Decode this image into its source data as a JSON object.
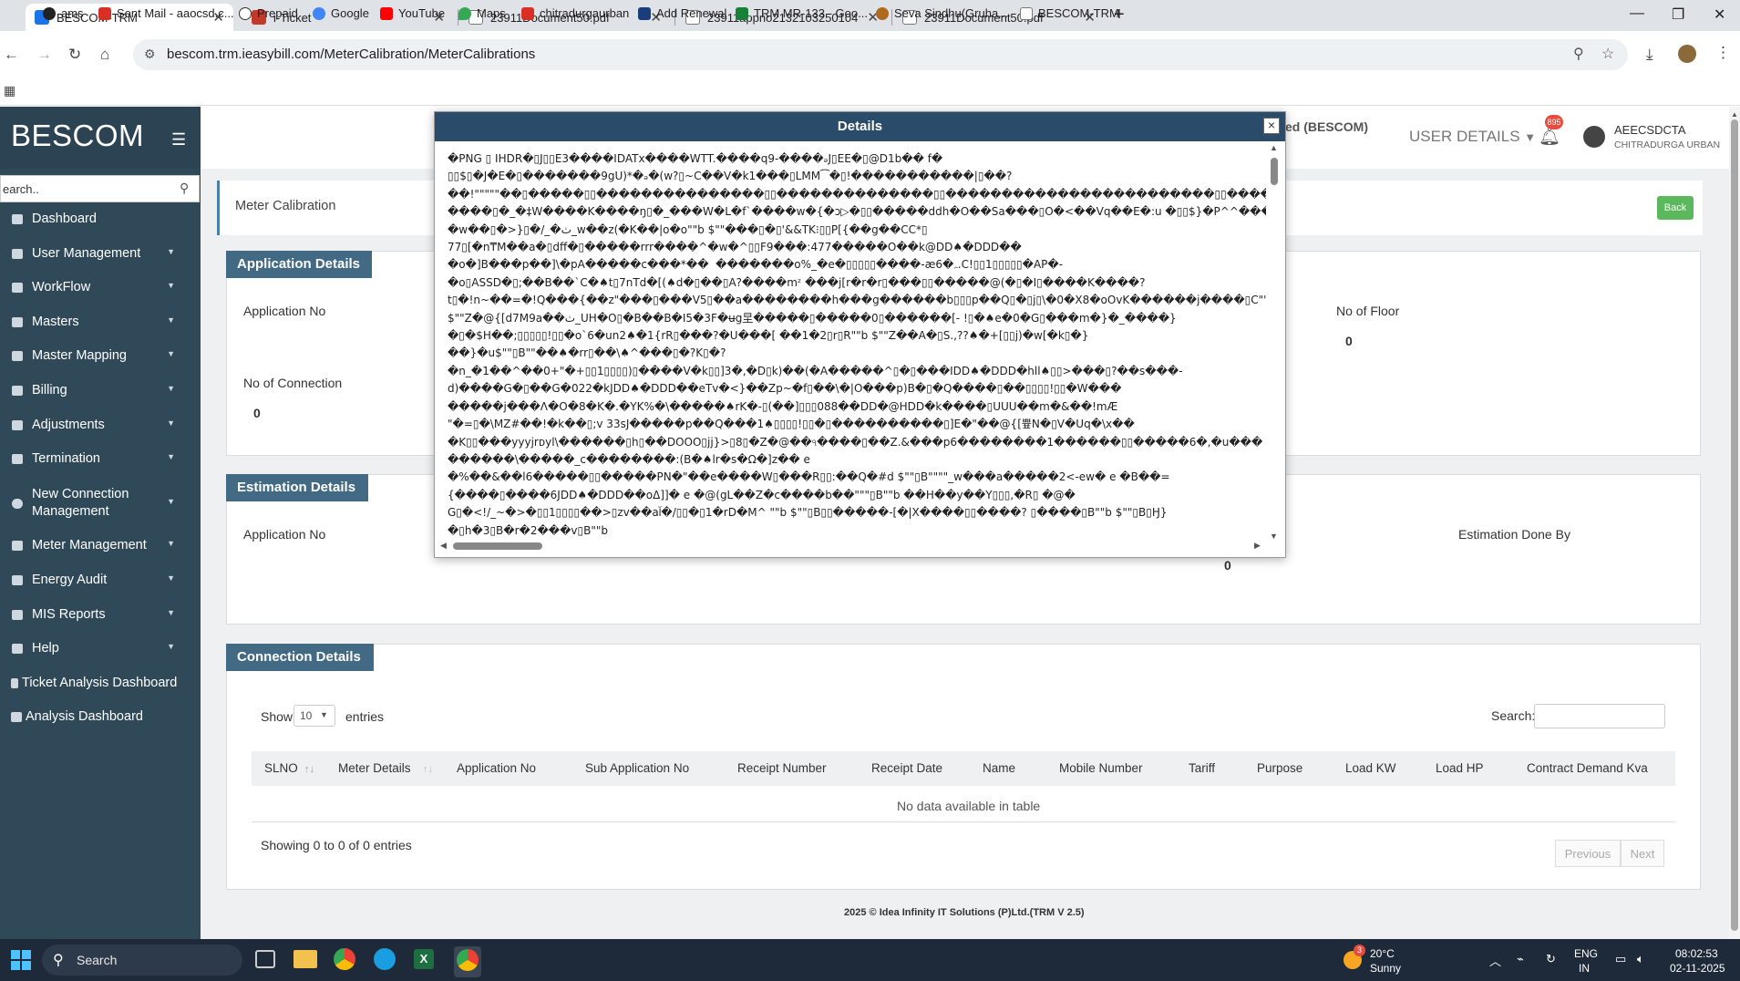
{
  "browser": {
    "tabs": [
      {
        "title": "BESCOM-TRM",
        "active": true
      },
      {
        "title": "i-Ticket",
        "active": false
      },
      {
        "title": "23911Document50.pdf",
        "active": false
      },
      {
        "title": "23911appno2132103250104ae",
        "active": false
      },
      {
        "title": "23911Document50.pdf",
        "active": false
      }
    ],
    "url": "bescom.trm.ieasybill.com/MeterCalibration/MeterCalibrations",
    "bookmarks": [
      "ams",
      "Sent Mail - aaocsd.c...",
      "Prepaid",
      "Google",
      "YouTube",
      "Maps",
      "chitradurgaurban",
      "Add Renewal",
      "TRM MR-133 - Goo...",
      "Seva Sindhu(Gruha...",
      "BESCOM-TRM"
    ]
  },
  "sidebar": {
    "brand": "BESCOM",
    "search_placeholder": "earch..",
    "items": [
      {
        "label": "Dashboard",
        "chevron": false
      },
      {
        "label": "User Management",
        "chevron": true
      },
      {
        "label": "WorkFlow",
        "chevron": true
      },
      {
        "label": "Masters",
        "chevron": true
      },
      {
        "label": "Master Mapping",
        "chevron": true
      },
      {
        "label": "Billing",
        "chevron": true
      },
      {
        "label": "Adjustments",
        "chevron": true
      },
      {
        "label": "Termination",
        "chevron": true
      },
      {
        "label": "New Connection Management",
        "chevron": true
      },
      {
        "label": "Meter Management",
        "chevron": true
      },
      {
        "label": "Energy Audit",
        "chevron": true
      },
      {
        "label": "MIS Reports",
        "chevron": true
      },
      {
        "label": "Help",
        "chevron": true
      },
      {
        "label": "Ticket Analysis Dashboard",
        "chevron": false
      },
      {
        "label": "Analysis Dashboard",
        "chevron": false
      }
    ]
  },
  "header": {
    "org_partial": "ed (BESCOM)",
    "user_details": "USER DETAILS",
    "notif_count": "895",
    "user_name": "AEECSDCTA",
    "user_sub": "CHITRADURGA URBAN"
  },
  "page": {
    "breadcrumb": "Meter Calibration",
    "back": "Back",
    "application_details": {
      "title": "Application Details",
      "application_no_label": "Application No",
      "no_of_floor_label": "No of Floor",
      "no_of_floor_value": "0",
      "no_of_connection_label": "No of Connection",
      "no_of_connection_value": "0"
    },
    "estimation_details": {
      "title": "Estimation Details",
      "application_no_label": "Application No",
      "estimation_done_by_label": "Estimation Done By",
      "value": "0"
    },
    "connection_details": {
      "title": "Connection Details",
      "show": "Show",
      "entries_select": "10",
      "entries": "entries",
      "search_label": "Search:",
      "columns": [
        "SLNO",
        "Meter Details",
        "Application No",
        "Sub Application No",
        "Receipt Number",
        "Receipt Date",
        "Name",
        "Mobile Number",
        "Tariff",
        "Purpose",
        "Load KW",
        "Load HP",
        "Contract Demand Kva"
      ],
      "empty": "No data available in table",
      "info": "Showing 0 to 0 of 0 entries",
      "previous": "Previous",
      "next": "Next"
    },
    "footer": "2025 © Idea Infinity IT Solutions (P)Ltd.(TRM V 2.5)"
  },
  "modal": {
    "title": "Details",
    "close": "×",
    "lines": [
      "�PNG ▯ IHDR�▯J▯▯E3����IDATx����WTT.����q9-����ₔJ▯EE�▯@D1b�� f�",
      "▯▯$▯�J�E�▯�������9gU)*�ₔ�(w?▯~C��V�k1���▯LMM⁀�▯!�����������|▯��?",
      "��!\"\"\"\"\"��▯�����▯▯���������������▯▯��������������▯▯������������������������▯▯��������",
      "����▯�_�‡W����K����ŋ▯�_���W�L�f`����w�{�ↄ▷�▯▯�����ddh�O��Sa���▯O�<��Vq��E�:u �▯▯$}�P^^���RE~-",
      "�w��▯�>}▯�/_�ٺ_w��z(�K��|o�o\"\"b $\"\"���▯�▯'&&TK⁝▯▯P[{��g��CC*▯",
      "77▯[�n₸M��a�▯dff�▯�����rrr����^�w�^▯▯F9���:477�����O��k@DD♠�DDD��",
      "�o�]B���p��]\\�pA�����c���*��  �������o%_�e�▯▯▯▯▯����-æ6�ﮧ.C!▯▯1▯▯▯▯▯�AP�-",
      "�o▯ASSD�▯;��B��`C�♠t▯7nTd�[(♠d�▯��▯A?����mᶻ ���j[r�r�r▯���▯▯�����@(�▯�I▯����K����?",
      "t▯�!n~��=�!Q���{��z\"���▯���V5▯��a��������h���g������b▯▯▯p��Q▯�▯j▯\\�0�X8�oOvK������j����▯C\"\"b",
      "$\"\"Z�@{[d7M9a��ٺ_UH�O▯�B��B�I5�3F�ʉg圼�����▯�����0▯������[- !▯�♠e�0�G▯���m�}�_����}",
      "�▯�$H��;▯▯▯▯▯!▯▯�o`6�un2♠�1{rR▯���?�U���[ ��1�2▯r▯R\"\"b $\"\"Z��A�▯S.,??♠�+[▯▯j)�w[�k▯�}",
      "��}�u$\"\"▯B\"\"��♠�rr▯��\\♠^���▯�?K▯�?",
      "�n_�1��^��0+\"�+▯▯1▯▯▯▯)▯����V�k▯▯]3�,�D▯k)��(�A�����^▯�▯���IDD♠�DDD�hll♠▯▯>���▯?��s���-",
      "d)����G�▯��G�022�kJDD♠�DDD��eTv�<}��Zp~�f▯��\\�|O���p)B�▯�Q����▯��▯▯▯▯!▯▯�W���",
      "�����j���Λ�O�8�K�.�YK%�\\�����♠rK�-▯(��]▯▯▯088��DD�@HDD�k����▯UUU��m�&��!mÆ",
      "\"�=▯�\\MZ#��!�k��▯;v 33sJ�����p��Q���1♠▯▯▯▯!▯▯�▯����������▯]E�\"��@{[쁖N�▯V�Uq�\\x��",
      "�K▯▯���yyyjrᴅyl\\������▯h▯��DOOO▯jj}>▯8▯�Z�@��ঀ����▯��Z.&���p6��������1������▯▯�����6�,�u���",
      "������\\�����_c��������:(B�♠lr�s�Ω�]z�� e",
      "�%��&��l6�����▯▯�����PN�\"��e����W▯���R▯▯:��Q�#d $\"\"▯B\"\"\"\"_w���a�����2<-ew� e �B��=",
      "{����▯����6JDD♠�DDD��oΔ]]� e �@(gL��Z�c����b��\"\"\"▯B\"\"b ��H��y��Y▯▯▯,�R▯ �@�",
      "G▯�<!/_~�>�▯▯1▯▯▯▯��>▯zv��al᷃�/▯▯�▯1�rD�M^ \"\"b $\"\"▯B▯▯�����-[�|X����▯▯����? ▯����▯B\"\"b $\"\"▯B▯Ӈ}",
      "�▯h�3▯B�r�2���v▯B\"\"b"
    ]
  },
  "taskbar": {
    "search": "Search",
    "weather_temp": "20°C",
    "weather_desc": "Sunny",
    "weather_badge": "3",
    "lang1": "ENG",
    "lang2": "IN",
    "time": "08:02:53",
    "date": "02-11-2025"
  }
}
